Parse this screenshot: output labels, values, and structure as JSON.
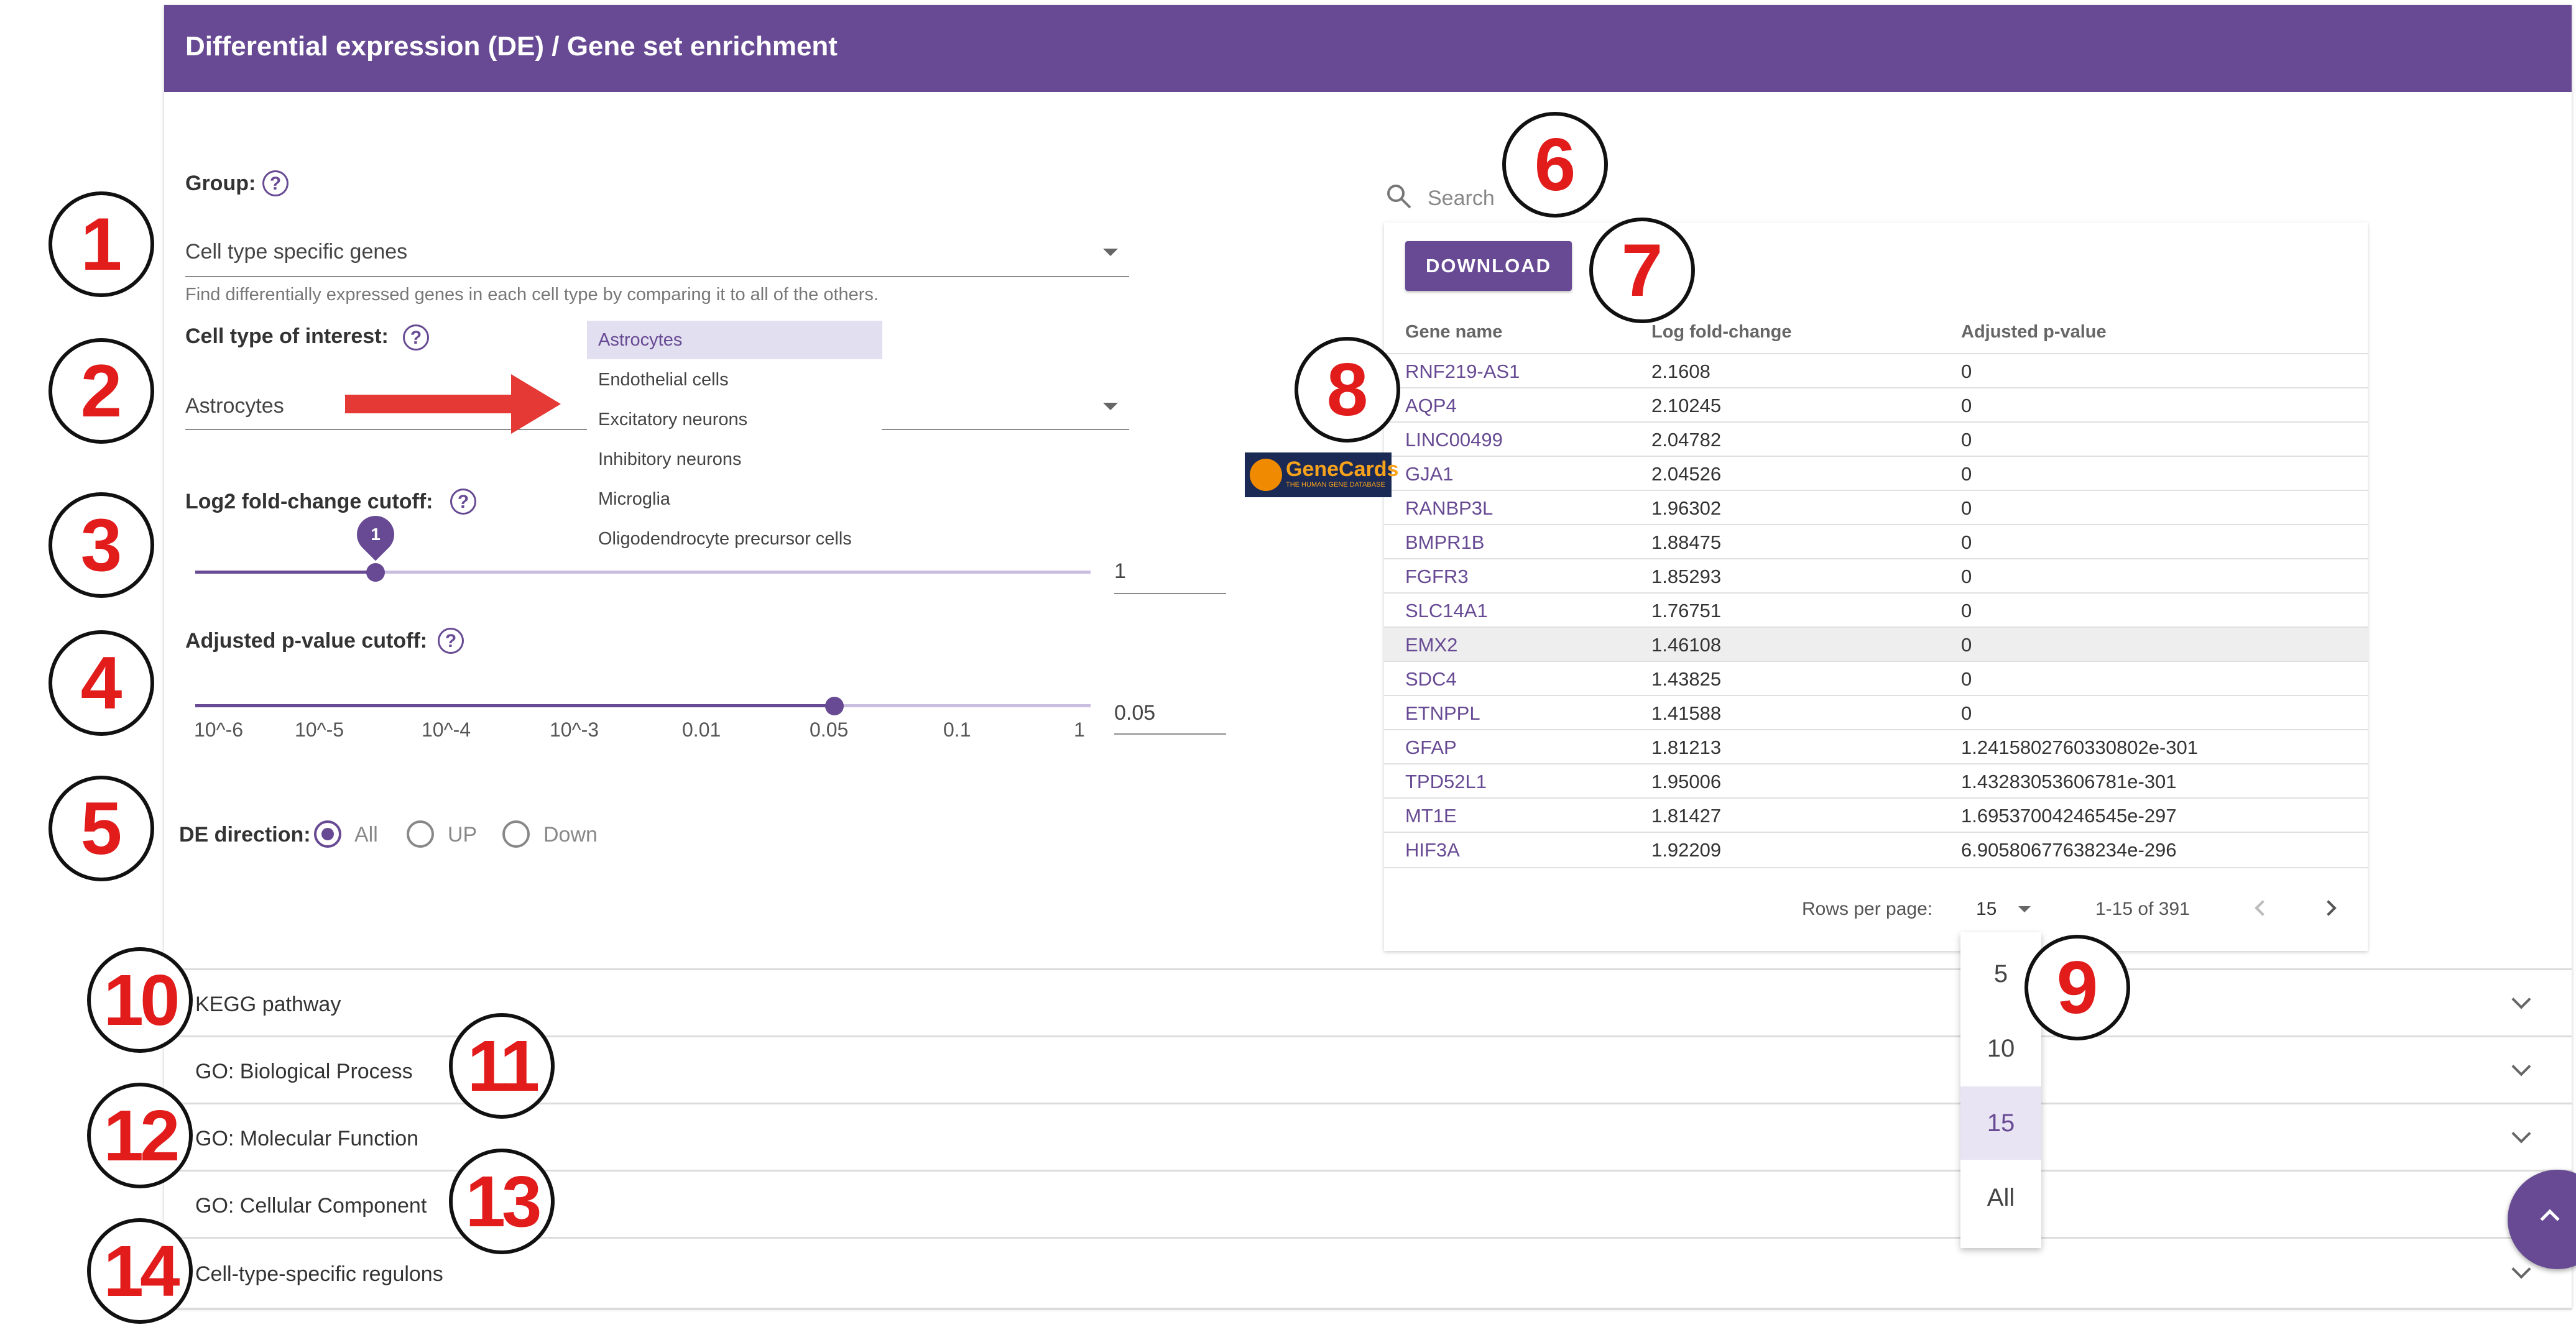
{
  "title": "Differential expression (DE) / Gene set enrichment",
  "group": {
    "label": "Group:",
    "value": "Cell type specific genes",
    "hint": "Find differentially expressed genes in each cell type by comparing it to all of the others."
  },
  "cell_type": {
    "label": "Cell type of interest:",
    "value": "Astrocytes",
    "options": [
      "Astrocytes",
      "Endothelial cells",
      "Excitatory neurons",
      "Inhibitory neurons",
      "Microglia",
      "Oligodendrocyte precursor cells"
    ]
  },
  "fold_change": {
    "label": "Log2 fold-change cutoff:",
    "value": "1",
    "bubble": "1"
  },
  "pvalue": {
    "label": "Adjusted p-value cutoff:",
    "value": "0.05",
    "ticks": [
      "10^-6",
      "10^-5",
      "10^-4",
      "10^-3",
      "0.01",
      "0.05",
      "0.1",
      "1"
    ]
  },
  "direction": {
    "label": "DE direction:",
    "options": [
      "All",
      "UP",
      "Down"
    ],
    "selected": "All"
  },
  "search": {
    "placeholder": "Search"
  },
  "download_label": "DOWNLOAD",
  "genecards": {
    "name": "GeneCards",
    "tagline": "THE HUMAN GENE DATABASE"
  },
  "table": {
    "headers": [
      "Gene name",
      "Log fold-change",
      "Adjusted p-value"
    ],
    "rows": [
      [
        "RNF219-AS1",
        "2.1608",
        "0"
      ],
      [
        "AQP4",
        "2.10245",
        "0"
      ],
      [
        "LINC00499",
        "2.04782",
        "0"
      ],
      [
        "GJA1",
        "2.04526",
        "0"
      ],
      [
        "RANBP3L",
        "1.96302",
        "0"
      ],
      [
        "BMPR1B",
        "1.88475",
        "0"
      ],
      [
        "FGFR3",
        "1.85293",
        "0"
      ],
      [
        "SLC14A1",
        "1.76751",
        "0"
      ],
      [
        "EMX2",
        "1.46108",
        "0"
      ],
      [
        "SDC4",
        "1.43825",
        "0"
      ],
      [
        "ETNPPL",
        "1.41588",
        "0"
      ],
      [
        "GFAP",
        "1.81213",
        "1.2415802760330802e-301"
      ],
      [
        "TPD52L1",
        "1.95006",
        "1.43283053606781e-301"
      ],
      [
        "MT1E",
        "1.81427",
        "1.69537004246545e-297"
      ],
      [
        "HIF3A",
        "1.92209",
        "6.90580677638234e-296"
      ]
    ],
    "rows_per_page_label": "Rows per page:",
    "rows_per_page": "15",
    "range": "1-15 of 391",
    "rpp_options": [
      "5",
      "10",
      "15",
      "All"
    ]
  },
  "accordions": [
    "KEGG pathway",
    "GO: Biological Process",
    "GO: Molecular Function",
    "GO: Cellular Component",
    "Cell-type-specific regulons"
  ],
  "callouts": [
    "1",
    "2",
    "3",
    "4",
    "5",
    "6",
    "7",
    "8",
    "9",
    "10",
    "11",
    "12",
    "13",
    "14"
  ],
  "colors": {
    "accent": "#674a93",
    "callout_text": "#e21b1b",
    "arrow": "#e53935"
  },
  "icons": [
    "search-icon",
    "help-icon",
    "chevron-down-icon",
    "chevron-left-icon",
    "chevron-right-icon",
    "chevron-up-icon",
    "arrow-right-icon"
  ]
}
